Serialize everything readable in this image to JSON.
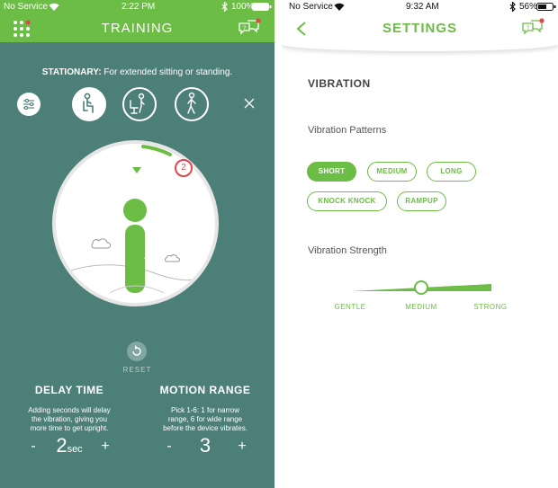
{
  "left": {
    "status": {
      "carrier": "No Service",
      "time": "2:22 PM",
      "battery": "100%"
    },
    "nav": {
      "title": "TRAINING",
      "menu_icon": "grid-menu-icon",
      "help_icon": "chat-help-icon",
      "has_notification": true
    },
    "mode": {
      "label": "STATIONARY:",
      "description": "For extended sitting or standing."
    },
    "postures": [
      {
        "name": "sitting",
        "icon": "sitting-person-icon",
        "active": true
      },
      {
        "name": "chair",
        "icon": "chair-person-icon",
        "active": false
      },
      {
        "name": "walking",
        "icon": "walking-person-icon",
        "active": false
      }
    ],
    "session": {
      "count": "2",
      "progress": 0.12
    },
    "reset": {
      "label": "RESET"
    },
    "delay": {
      "title": "DELAY TIME",
      "description": "Adding seconds will delay the vibration, giving you more time to get upright.",
      "minus": "-",
      "plus": "+",
      "value": "2",
      "unit": "sec"
    },
    "motion": {
      "title": "MOTION RANGE",
      "description": "Pick 1-6: 1 for narrow range, 6 for wide range before the device vibrates.",
      "minus": "-",
      "plus": "+",
      "value": "3"
    }
  },
  "right": {
    "status": {
      "carrier": "No Service",
      "time": "9:32 AM",
      "battery": "56%"
    },
    "nav": {
      "title": "SETTINGS",
      "back_icon": "chevron-left-icon",
      "help_icon": "chat-help-icon"
    },
    "section_title": "VIBRATION",
    "patterns_label": "Vibration Patterns",
    "patterns": [
      {
        "label": "SHORT",
        "selected": true
      },
      {
        "label": "MEDIUM",
        "selected": false
      },
      {
        "label": "LONG",
        "selected": false
      },
      {
        "label": "KNOCK KNOCK",
        "selected": false
      },
      {
        "label": "RAMPUP",
        "selected": false
      }
    ],
    "strength_label": "Vibration Strength",
    "strength": {
      "levels": [
        "GENTLE",
        "MEDIUM",
        "STRONG"
      ],
      "selected": "MEDIUM",
      "value": 0.5
    }
  },
  "colors": {
    "brand_green": "#6cbd45",
    "teal_bg": "#4b7f78",
    "alert_red": "#e2454f"
  }
}
